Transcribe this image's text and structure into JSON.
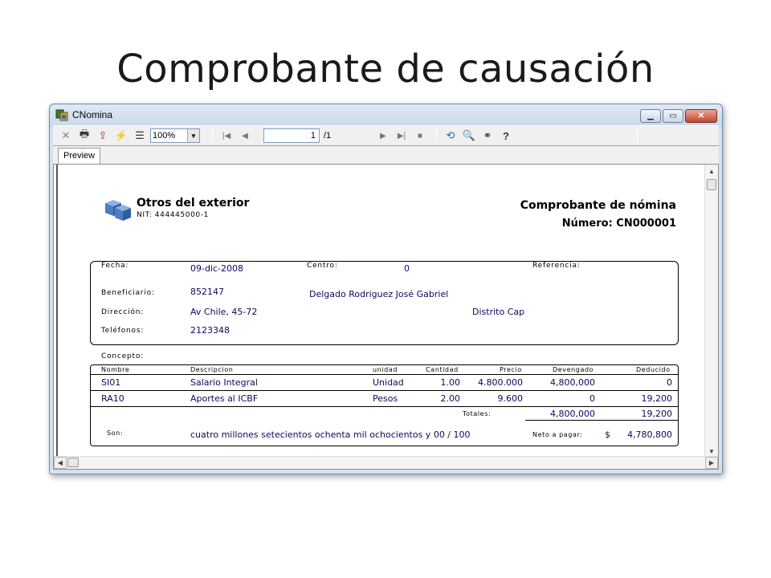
{
  "slide_title": "Comprobante de causación",
  "window": {
    "title": "CNomina",
    "zoom": "100%",
    "page_current": "1",
    "page_total": "/1",
    "tab_label": "Preview"
  },
  "company": {
    "name": "Otros del exterior",
    "nit": "NIT: 444445000-1"
  },
  "document": {
    "title": "Comprobante de nómina",
    "number": "Número: CN000001"
  },
  "header_fields": {
    "fecha_label": "Fecha:",
    "fecha_value": "09-dic-2008",
    "centro_label": "Centro:",
    "centro_value": "0",
    "referencia_label": "Referencia:",
    "beneficiario_label": "Beneficiario:",
    "beneficiario_id": "852147",
    "beneficiario_nombre": "Delgado Rodriguez José Gabriel",
    "direccion_label": "Dirección:",
    "direccion_value": "Av Chile, 45-72",
    "ciudad_value": "Distrito Cap",
    "telefonos_label": "Teléfonos:",
    "telefonos_value": "2123348"
  },
  "concepto_label": "Concepto:",
  "table": {
    "headers": [
      "Nombre",
      "Descripcion",
      "unidad",
      "Cantidad",
      "Precio",
      "Devengado",
      "Deducido"
    ],
    "rows": [
      [
        "SI01",
        "Salario Integral",
        "Unidad",
        "1.00",
        "4.800.000",
        "4,800,000",
        "0"
      ],
      [
        "RA10",
        "Aportes al ICBF",
        "Pesos",
        "2.00",
        "9.600",
        "0",
        "19,200"
      ]
    ],
    "totales_label": "Totales:",
    "total_devengado": "4,800,000",
    "total_deducido": "19,200",
    "son_label": "Son:",
    "son_value": "cuatro millones setecientos ochenta mil ochocientos y 00 / 100",
    "neto_label": "Neto a pagar:",
    "neto_currency": "$",
    "neto_value": "4,780,800"
  },
  "icons": {
    "toolbar": [
      "close-icon",
      "print-icon",
      "export-icon",
      "lightning-icon",
      "tree-icon",
      "first-page-icon",
      "prev-page-icon",
      "next-page-icon",
      "last-page-icon",
      "stop-icon",
      "refresh-search-icon",
      "search-doc-icon",
      "binoculars-icon",
      "help-icon"
    ]
  },
  "colors": {
    "value_text": "#0a0a5e",
    "logo_blue": "#4a7fc0"
  }
}
